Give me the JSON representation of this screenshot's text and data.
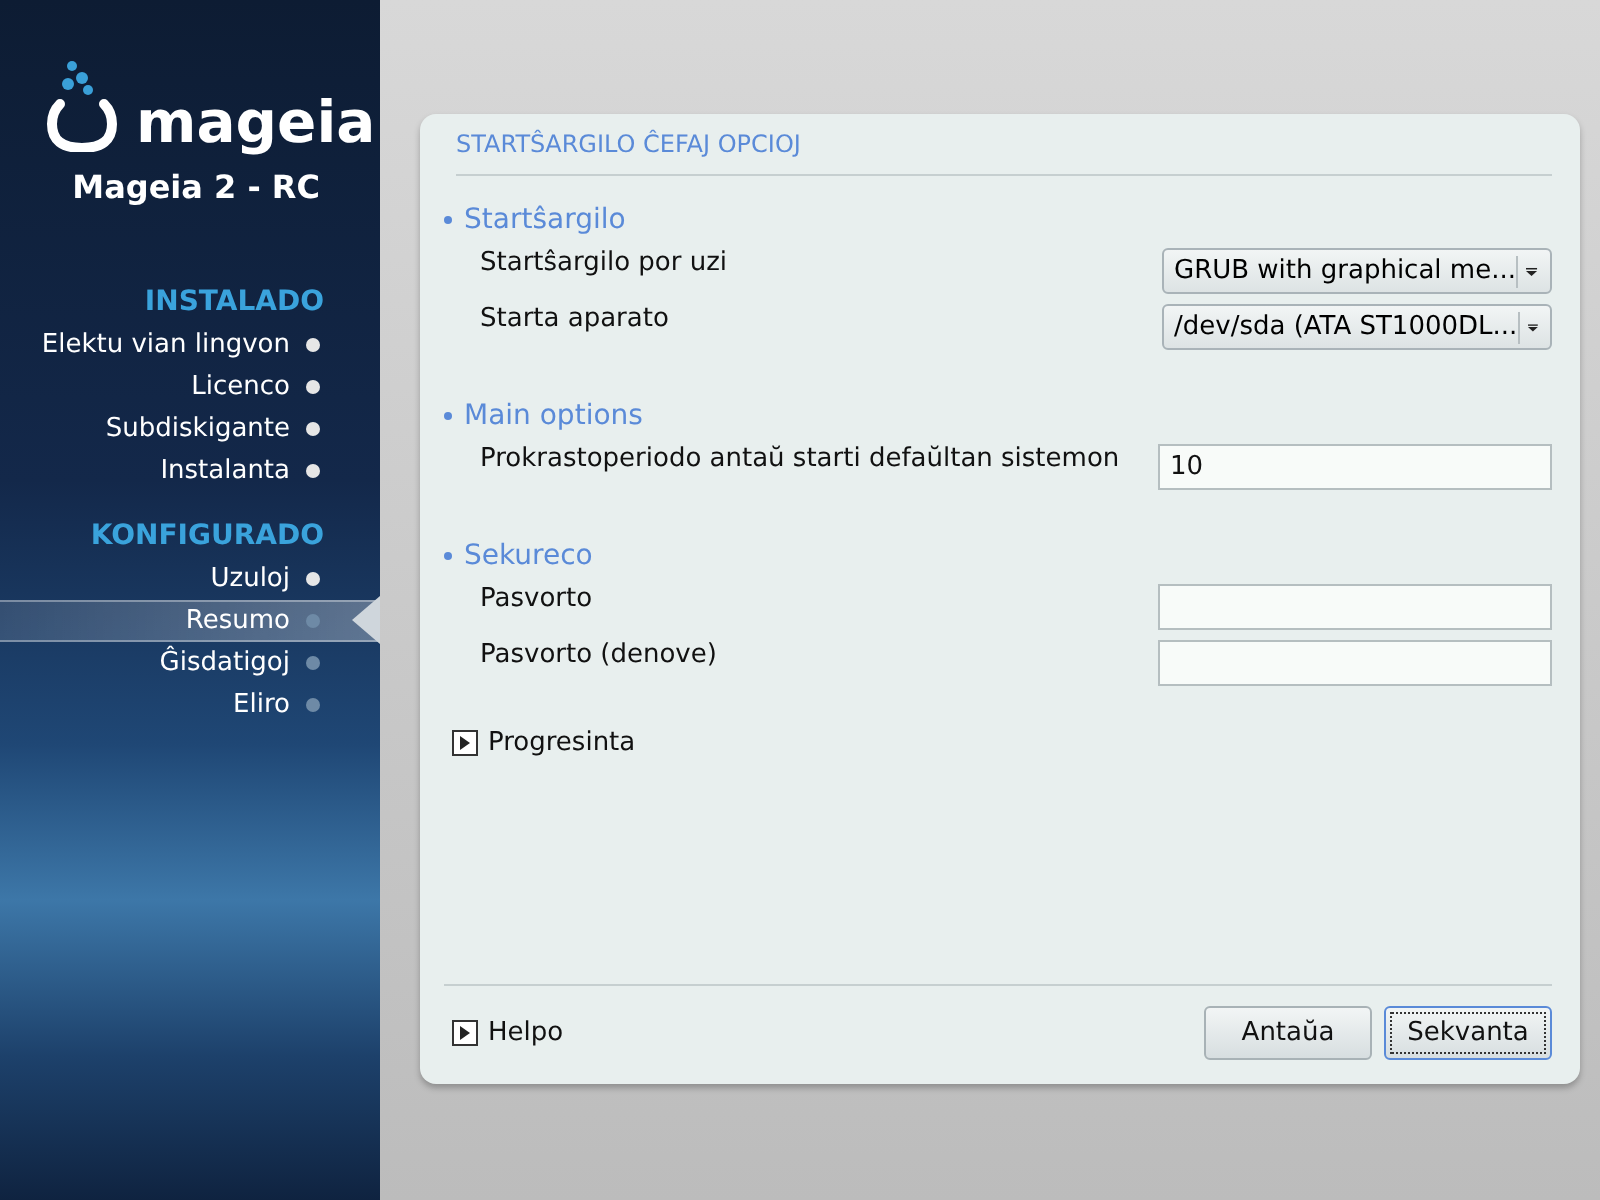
{
  "sidebar": {
    "logo_text": "mageia",
    "version": "Mageia 2 - RC",
    "sections": [
      {
        "title": "INSTALADO",
        "items": [
          {
            "label": "Elektu vian lingvon",
            "completed": true,
            "selected": false
          },
          {
            "label": "Licenco",
            "completed": true,
            "selected": false
          },
          {
            "label": "Subdiskigante",
            "completed": true,
            "selected": false
          },
          {
            "label": "Instalanta",
            "completed": true,
            "selected": false
          }
        ]
      },
      {
        "title": "KONFIGURADO",
        "items": [
          {
            "label": "Uzuloj",
            "completed": true,
            "selected": false
          },
          {
            "label": "Resumo",
            "completed": false,
            "selected": true
          },
          {
            "label": "Ĝisdatigoj",
            "completed": false,
            "selected": false
          },
          {
            "label": "Eliro",
            "completed": false,
            "selected": false
          }
        ]
      }
    ]
  },
  "panel": {
    "title": "STARTŜARGILO ĈEFAJ OPCIOJ",
    "groups": [
      {
        "title": "Startŝargilo",
        "rows": [
          {
            "kind": "combo",
            "label": "Startŝargilo por uzi",
            "value": "GRUB with graphical me..."
          },
          {
            "kind": "combo",
            "label": "Starta aparato",
            "value": "/dev/sda (ATA ST1000DL..."
          }
        ]
      },
      {
        "title": "Main options",
        "rows": [
          {
            "kind": "entry",
            "label": "Prokrastoperiodo antaŭ starti defaŭltan sistemon",
            "value": "10"
          }
        ]
      },
      {
        "title": "Sekureco",
        "rows": [
          {
            "kind": "entry",
            "label": "Pasvorto",
            "value": ""
          },
          {
            "kind": "entry",
            "label": "Pasvorto (denove)",
            "value": ""
          }
        ]
      }
    ],
    "expander": {
      "label": "Progresinta",
      "expanded": false
    },
    "help": {
      "label": "Helpo",
      "expanded": false
    },
    "buttons": [
      {
        "label": "Antaŭa",
        "focused": false
      },
      {
        "label": "Sekvanta",
        "focused": true
      }
    ]
  }
}
